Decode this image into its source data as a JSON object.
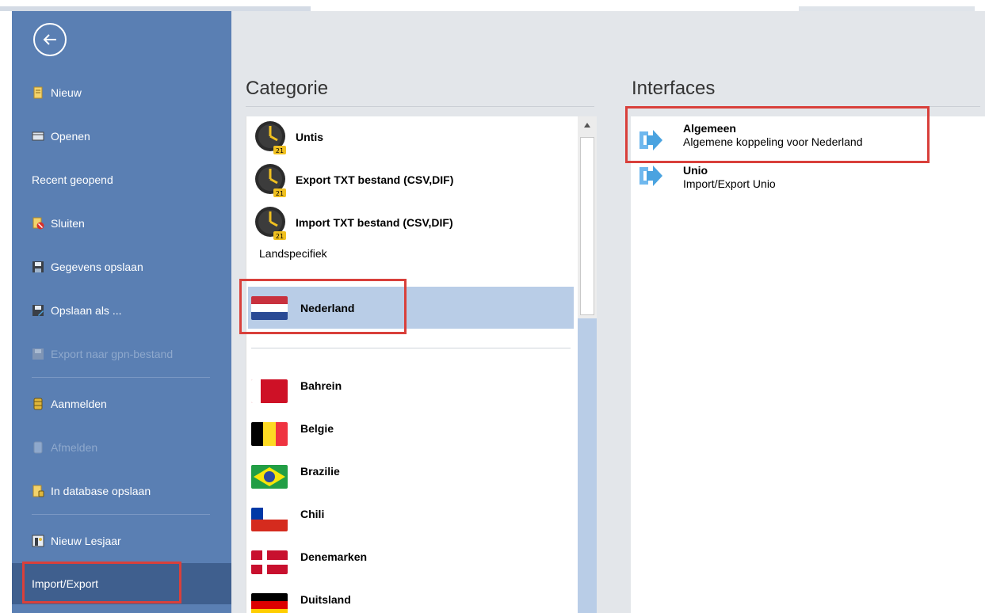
{
  "sidebar": {
    "items": [
      {
        "label": "Nieuw",
        "icon": "new-document-icon",
        "disabled": false
      },
      {
        "label": "Openen",
        "icon": "folder-open-icon",
        "disabled": false
      },
      {
        "label": "Recent geopend",
        "icon": "",
        "disabled": false
      },
      {
        "label": "Sluiten",
        "icon": "close-document-icon",
        "disabled": false
      },
      {
        "label": "Gegevens opslaan",
        "icon": "save-icon",
        "disabled": false
      },
      {
        "label": "Opslaan als ...",
        "icon": "save-as-icon",
        "disabled": false
      },
      {
        "label": "Export naar gpn-bestand",
        "icon": "export-icon",
        "disabled": true
      },
      {
        "label": "Aanmelden",
        "icon": "database-login-icon",
        "disabled": false
      },
      {
        "label": "Afmelden",
        "icon": "database-logout-icon",
        "disabled": true
      },
      {
        "label": "In database opslaan",
        "icon": "database-save-icon",
        "disabled": false
      },
      {
        "label": "Nieuw Lesjaar",
        "icon": "new-schoolyear-icon",
        "disabled": false
      },
      {
        "label": "Import/Export",
        "icon": "",
        "disabled": false
      }
    ]
  },
  "categorie": {
    "title": "Categorie",
    "programs": [
      {
        "label": "Untis",
        "icon": "untis-clock-icon"
      },
      {
        "label": "Export TXT bestand (CSV,DIF)",
        "icon": "untis-clock-icon"
      },
      {
        "label": "Import TXT bestand (CSV,DIF)",
        "icon": "untis-clock-icon"
      }
    ],
    "section_label": "Landspecifiek",
    "selected_country": "Nederland",
    "countries": [
      "Bahrein",
      "Belgie",
      "Brazilie",
      "Chili",
      "Denemarken",
      "Duitsland"
    ]
  },
  "interfaces": {
    "title": "Interfaces",
    "items": [
      {
        "title": "Algemeen",
        "subtitle": "Algemene koppeling voor Nederland",
        "icon": "arrow-right-icon"
      },
      {
        "title": "Unio",
        "subtitle": "Import/Export Unio",
        "icon": "arrow-right-icon"
      }
    ]
  },
  "colors": {
    "sidebar": "#5a7fb3",
    "sidebar_active": "#3f5f8e",
    "selection": "#b9cde7",
    "highlight": "#d9403b",
    "panel_bg": "#e3e6ea"
  }
}
